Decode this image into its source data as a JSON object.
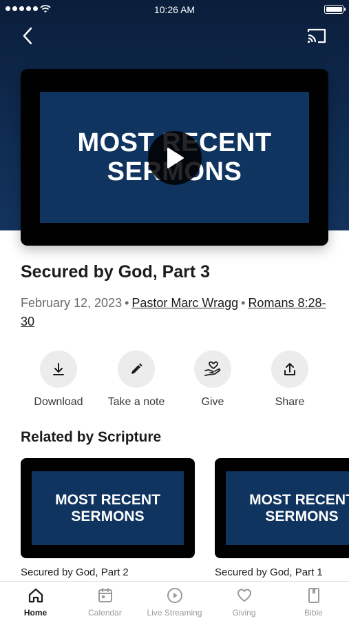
{
  "status_bar": {
    "time": "10:26 AM"
  },
  "player": {
    "art_line1": "MOST RECENT",
    "art_line2": "SERMONS"
  },
  "sermon": {
    "title": "Secured by God, Part 3",
    "date": "February 12, 2023",
    "speaker": "Pastor Marc Wragg",
    "scripture": "Romans 8:28-30",
    "separator": "•"
  },
  "actions": [
    {
      "label": "Download",
      "icon": "download-icon"
    },
    {
      "label": "Take a note",
      "icon": "pencil-icon"
    },
    {
      "label": "Give",
      "icon": "heart-hand-icon"
    },
    {
      "label": "Share",
      "icon": "share-icon"
    }
  ],
  "related": {
    "heading": "Related by Scripture",
    "items": [
      {
        "art_line1": "MOST RECENT",
        "art_line2": "SERMONS",
        "title": "Secured by God, Part 2"
      },
      {
        "art_line1": "MOST RECENT",
        "art_line2": "SERMONS",
        "title": "Secured by God, Part 1"
      }
    ]
  },
  "tabbar": {
    "active": "Home",
    "tabs": [
      {
        "label": "Home",
        "icon": "home-icon"
      },
      {
        "label": "Calendar",
        "icon": "calendar-icon"
      },
      {
        "label": "Live Streaming",
        "icon": "play-circle-icon"
      },
      {
        "label": "Giving",
        "icon": "heart-icon"
      },
      {
        "label": "Bible",
        "icon": "book-icon"
      }
    ]
  },
  "colors": {
    "hero_dark": "#0b1e3b",
    "hero_light": "#13335d",
    "art_blue": "#0f3460",
    "text_primary": "#1c1c1e",
    "text_secondary": "#6b6b6b"
  }
}
